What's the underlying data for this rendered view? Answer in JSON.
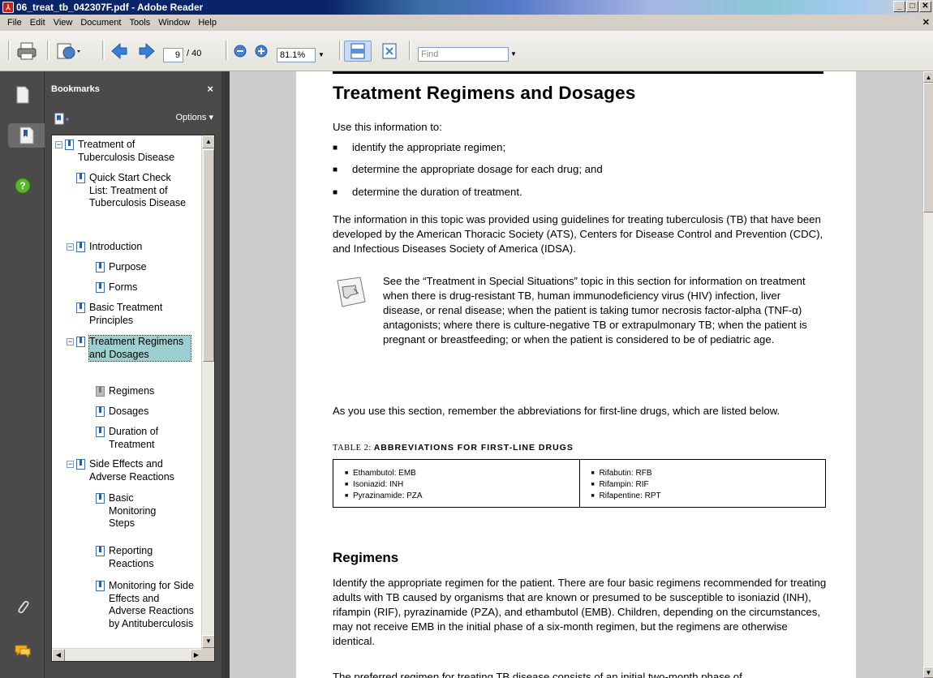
{
  "window": {
    "title": "06_treat_tb_042307F.pdf - Adobe Reader",
    "controls": [
      "_",
      "□",
      "✕"
    ]
  },
  "menu": [
    "File",
    "Edit",
    "View",
    "Document",
    "Tools",
    "Window",
    "Help"
  ],
  "toolbar": {
    "page_current": "9",
    "page_total": "/ 40",
    "zoom": "81.1%",
    "find_placeholder": "Find"
  },
  "bookmarks": {
    "title": "Bookmarks",
    "close": "×",
    "options": "Options ▾",
    "items": [
      {
        "label": "Treatment of Tuberculosis Disease",
        "level": 0,
        "expander": "−",
        "selected": false,
        "icon": "bookmark-icon"
      },
      {
        "label": "Quick Start Check List:  Treatment of Tuberculosis Disease",
        "level": 1,
        "expander": "",
        "selected": false,
        "icon": "bookmark-icon"
      },
      {
        "label": "Introduction",
        "level": 1,
        "expander": "−",
        "selected": false,
        "icon": "bookmark-icon"
      },
      {
        "label": "Purpose",
        "level": 2,
        "expander": "",
        "selected": false,
        "icon": "bookmark-icon"
      },
      {
        "label": "Forms",
        "level": 2,
        "expander": "",
        "selected": false,
        "icon": "bookmark-icon"
      },
      {
        "label": "Basic Treatment Principles",
        "level": 1,
        "expander": "",
        "selected": false,
        "icon": "bookmark-icon"
      },
      {
        "label": "Treatment Regimens and Dosages",
        "level": 1,
        "expander": "−",
        "selected": true,
        "icon": "bookmark-icon"
      },
      {
        "label": "Regimens",
        "level": 2,
        "expander": "",
        "selected": false,
        "icon": "bookmark-gray-icon"
      },
      {
        "label": "Dosages",
        "level": 2,
        "expander": "",
        "selected": false,
        "icon": "bookmark-icon"
      },
      {
        "label": "Duration of Treatment",
        "level": 2,
        "expander": "",
        "selected": false,
        "icon": "bookmark-icon"
      },
      {
        "label": "Side Effects and Adverse Reactions",
        "level": 1,
        "expander": "−",
        "selected": false,
        "icon": "bookmark-icon"
      },
      {
        "label": "Basic Monitoring Steps",
        "level": 2,
        "expander": "",
        "selected": false,
        "icon": "bookmark-icon"
      },
      {
        "label": "Reporting Reactions",
        "level": 2,
        "expander": "",
        "selected": false,
        "icon": "bookmark-icon"
      },
      {
        "label": "Monitoring for Side Effects and Adverse Reactions  by Antituberculosis",
        "level": 2,
        "expander": "",
        "selected": false,
        "icon": "bookmark-icon"
      }
    ]
  },
  "document": {
    "title": "Treatment Regimens and Dosages",
    "intro": "Use this information to:",
    "bullets": [
      "identify the appropriate regimen;",
      "determine the appropriate dosage for each drug; and",
      "determine the duration of treatment."
    ],
    "para1": "The information in this topic was provided using guidelines for treating tuberculosis (TB) that have been developed by the American Thoracic Society (ATS), Centers for Disease Control and Prevention (CDC), and Infectious Diseases Society of America (IDSA).",
    "note": "See the “Treatment in Special Situations” topic in this section for information on treatment when there is drug-resistant TB, human immunodeficiency virus (HIV) infection, liver disease, or renal disease; when the patient is taking tumor necrosis factor-alpha (TNF-α) antagonists; where there is culture-negative TB or extrapulmonary TB; when the patient is pregnant or breastfeeding; or when the patient is considered to be of pediatric age.",
    "para2": "As you use this section, remember the abbreviations for first-line drugs, which are listed below.",
    "table_prefix": "TABLE 2:",
    "table_caption": "ABBREVIATIONS FOR FIRST-LINE DRUGS",
    "table_left": [
      "Ethambutol: EMB",
      "Isoniazid: INH",
      "Pyrazinamide: PZA"
    ],
    "table_right": [
      "Rifabutin: RFB",
      "Rifampin: RIF",
      "Rifapentine: RPT"
    ],
    "section_heading": "Regimens",
    "para3": "Identify the appropriate regimen for the patient. There are four basic regimens recommended for treating adults with TB caused by organisms that are known or presumed to be susceptible to isoniazid (INH), rifampin (RIF), pyrazinamide (PZA), and ethambutol (EMB). Children, depending on the circumstances, may not receive EMB in the initial phase of a six-month regimen, but the regimens are otherwise identical.",
    "para4": "The preferred regimen for treating TB disease consists of an initial two-month phase of"
  }
}
